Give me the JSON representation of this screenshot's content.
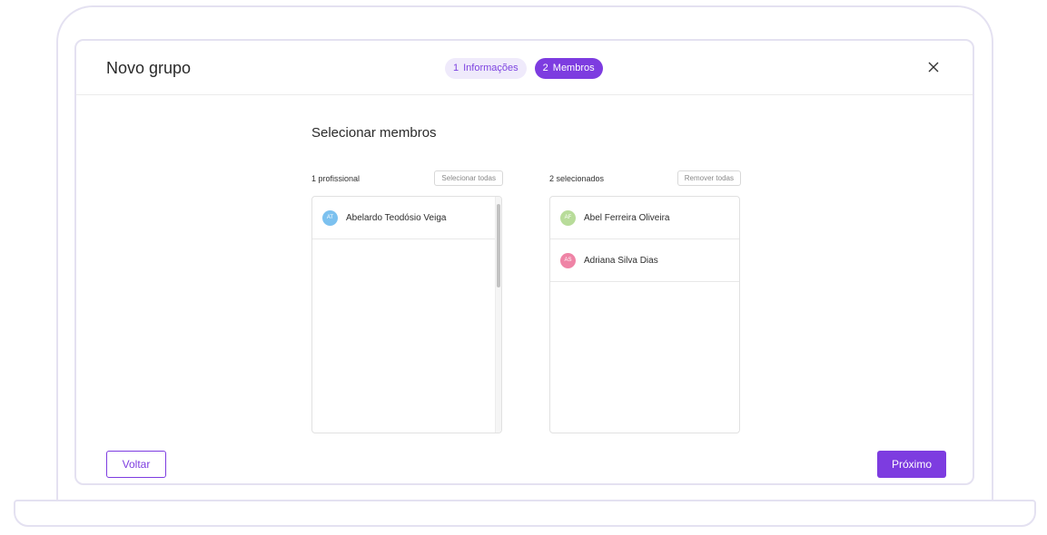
{
  "modal": {
    "title": "Novo grupo",
    "steps": [
      {
        "number": "1",
        "label": "Informações",
        "state": "inactive"
      },
      {
        "number": "2",
        "label": "Membros",
        "state": "active"
      }
    ],
    "close_icon": "close-icon"
  },
  "section": {
    "title": "Selecionar membros"
  },
  "available": {
    "count_label": "1 profissional",
    "action_label": "Selecionar todas",
    "items": [
      {
        "initials": "AT",
        "name": "Abelardo Teodósio Veiga",
        "avatar_color": "#7cc1ef"
      }
    ]
  },
  "selected": {
    "count_label": "2 selecionados",
    "action_label": "Remover todas",
    "items": [
      {
        "initials": "AF",
        "name": "Abel Ferreira Oliveira",
        "avatar_color": "#b8dc9a"
      },
      {
        "initials": "AS",
        "name": "Adriana Silva Dias",
        "avatar_color": "#ef84a6"
      }
    ]
  },
  "footer": {
    "back_label": "Voltar",
    "next_label": "Próximo"
  },
  "colors": {
    "accent": "#7d3ce0",
    "accent_light": "#efeafb",
    "frame": "#e4e1f1"
  }
}
